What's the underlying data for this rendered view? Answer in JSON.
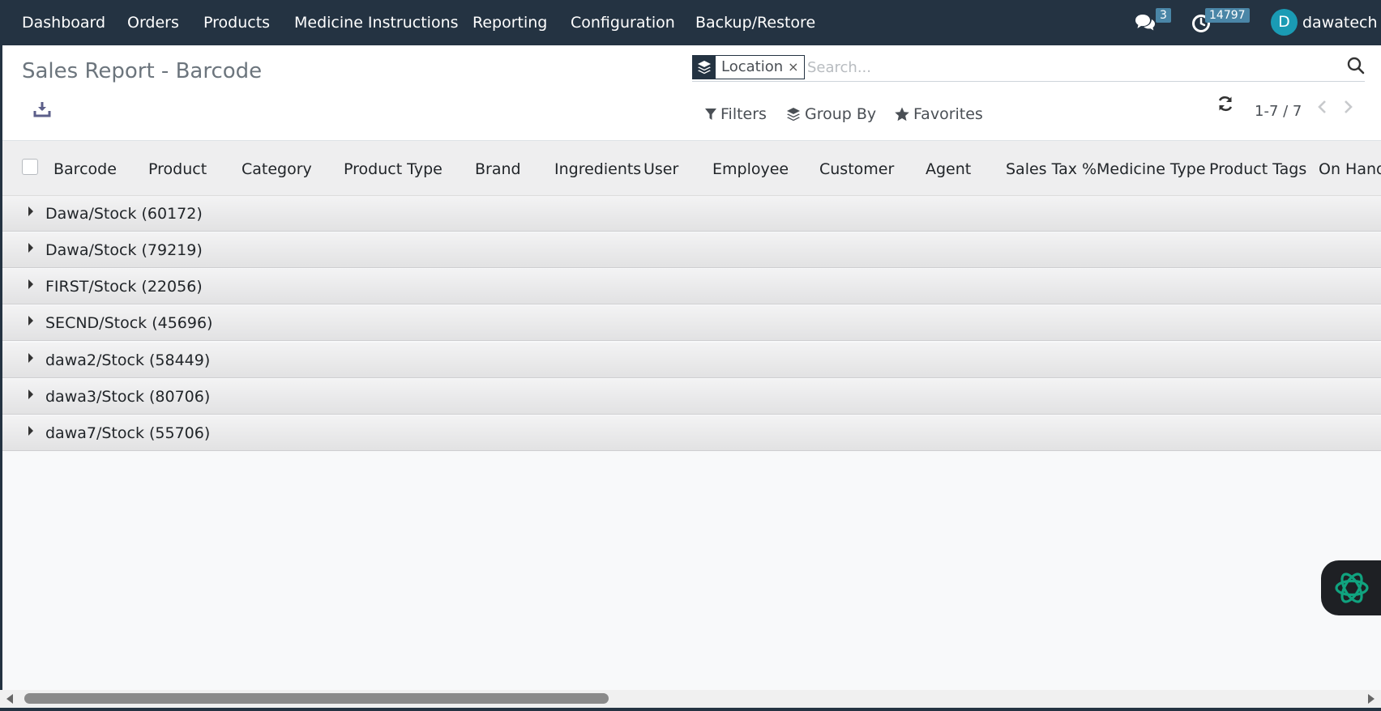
{
  "nav": {
    "menu": [
      "Dashboard",
      "Orders",
      "Products",
      "Medicine Instructions",
      "Reporting",
      "Configuration",
      "Backup/Restore"
    ],
    "messages_count": "3",
    "activities_count": "14797",
    "user_initial": "D",
    "user_name": "dawatech"
  },
  "page": {
    "title": "Sales Report - Barcode"
  },
  "search": {
    "facet_value": "Location",
    "facet_remove": "×",
    "placeholder": "Search..."
  },
  "toolbar": {
    "filters_label": "Filters",
    "group_by_label": "Group By",
    "favorites_label": "Favorites"
  },
  "pager": {
    "value": "1-7 / 7"
  },
  "table": {
    "columns": [
      "Barcode",
      "Product",
      "Category",
      "Product Type",
      "Brand",
      "Ingredients",
      "User",
      "Employee",
      "Customer",
      "Agent",
      "Sales Tax %",
      "Medicine Type",
      "Product Tags",
      "On Hand"
    ],
    "groups": [
      "Dawa/Stock (60172)",
      "Dawa/Stock (79219)",
      "FIRST/Stock (22056)",
      "SECND/Stock (45696)",
      "dawa2/Stock (58449)",
      "dawa3/Stock (80706)",
      "dawa7/Stock (55706)"
    ]
  },
  "icons": {
    "messages": "chat-bubbles-icon",
    "activities": "clock-icon",
    "download": "download-icon",
    "facet": "layers-icon",
    "search": "search-icon",
    "filter": "funnel-icon",
    "group_by": "layers-icon",
    "favorites": "star-icon",
    "refresh": "refresh-icon",
    "assistant": "openai-icon"
  },
  "colors": {
    "navbar": "#243342",
    "badge": "#4a86a7",
    "avatar": "#1a9bb4",
    "assistant_icon": "#10a37f"
  }
}
